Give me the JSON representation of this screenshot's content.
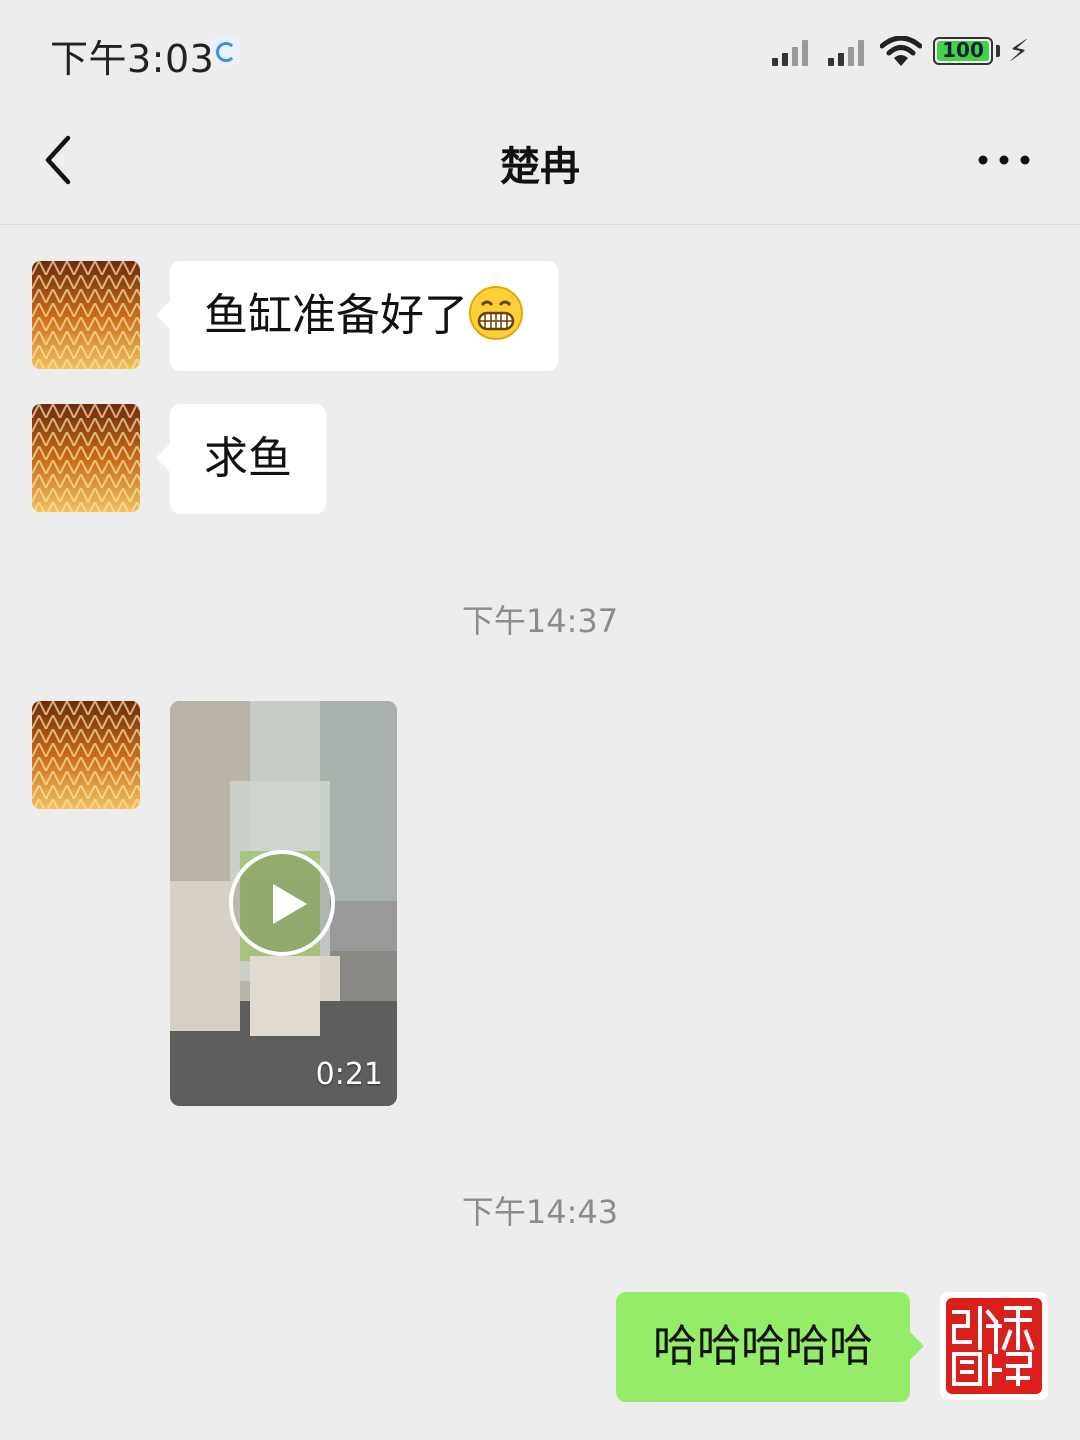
{
  "status_bar": {
    "time": "下午3:03",
    "battery": "100",
    "colors": {
      "battery_fill": "#43d04a"
    }
  },
  "header": {
    "title": "楚冉",
    "back_icon": "chevron-left-icon",
    "more_icon": "more-horizontal-icon"
  },
  "messages": [
    {
      "type": "text",
      "from": "other",
      "text": "鱼缸准备好了",
      "emoji": "grinning-face"
    },
    {
      "type": "text",
      "from": "other",
      "text": "求鱼"
    },
    {
      "type": "timestamp",
      "text": "下午14:37"
    },
    {
      "type": "video",
      "from": "other",
      "duration": "0:21"
    },
    {
      "type": "timestamp",
      "text": "下午14:43"
    },
    {
      "type": "text",
      "from": "me",
      "text": "哈哈哈哈哈"
    }
  ],
  "colors": {
    "background": "#ededed",
    "incoming_bubble": "#ffffff",
    "outgoing_bubble": "#95ec69",
    "timestamp": "#8c8c8c"
  }
}
